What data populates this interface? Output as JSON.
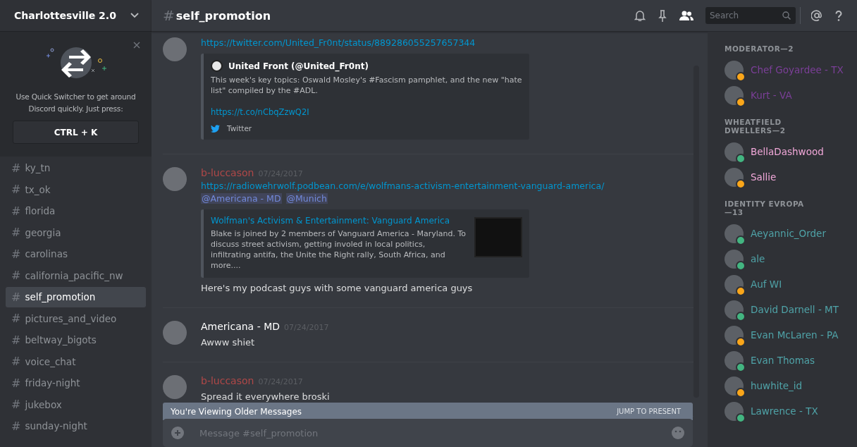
{
  "server": {
    "name": "Charlottesville 2.0"
  },
  "quick_switcher": {
    "text": "Use Quick Switcher to get around Discord quickly. Just press:",
    "shortcut": "CTRL + K"
  },
  "channels": [
    {
      "name": "ky_tn",
      "selected": false
    },
    {
      "name": "tx_ok",
      "selected": false
    },
    {
      "name": "florida",
      "selected": false
    },
    {
      "name": "georgia",
      "selected": false
    },
    {
      "name": "carolinas",
      "selected": false
    },
    {
      "name": "california_pacific_nw",
      "selected": false
    },
    {
      "name": "self_promotion",
      "selected": true
    },
    {
      "name": "pictures_and_video",
      "selected": false
    },
    {
      "name": "beltway_bigots",
      "selected": false
    },
    {
      "name": "voice_chat",
      "selected": false
    },
    {
      "name": "friday-night",
      "selected": false
    },
    {
      "name": "jukebox",
      "selected": false
    },
    {
      "name": "sunday-night",
      "selected": false
    }
  ],
  "header": {
    "hash": "#",
    "channel": "self_promotion",
    "search_placeholder": "Search",
    "members_on": true
  },
  "messages": [
    {
      "link": "https://twitter.com/United_Fr0nt/status/889286055257657344",
      "embed": {
        "kind": "tweet",
        "author": "United Front (@United_Fr0nt)",
        "description": "This week's key topics: Oswald Mosley's #Fascism pamphlet, and the new \"hate list\" compiled by the #ADL.",
        "link": "https://t.co/nCbqZzwQ2I",
        "footer": "Twitter"
      }
    },
    {
      "author": "b-luccason",
      "color": "#b04848",
      "timestamp": "07/24/2017",
      "link": "https://radiowehrwolf.podbean.com/e/wolfmans-activism-entertainment-vanguard-america/",
      "mentions": [
        "@Americana - MD",
        "@Munich"
      ],
      "embed": {
        "kind": "article",
        "title": "Wolfman's Activism & Entertainment: Vanguard America",
        "description": "Blake is joined by 2 members of Vanguard America - Maryland. To discuss street activism, getting involed in local politics, infiltrating antifa, the Unite the Right rally, South Africa, and more...."
      },
      "text": "Here's my podcast guys with some vanguard america guys"
    },
    {
      "author": "Americana - MD",
      "color": "#ffffff",
      "timestamp": "07/24/2017",
      "text": "Awww shiet"
    },
    {
      "author": "b-luccason",
      "color": "#b04848",
      "timestamp": "07/24/2017",
      "text": "Spread it everywhere broski"
    }
  ],
  "older_banner": {
    "text": "You're Viewing Older Messages",
    "action": "JUMP TO PRESENT"
  },
  "composer": {
    "placeholder": "Message #self_promotion"
  },
  "member_groups": [
    {
      "title": "MODERATOR—2",
      "color": "#7b3f98",
      "members": [
        {
          "name": "Chef Goyardee - TX",
          "color": "#faa61a"
        },
        {
          "name": "Kurt - VA",
          "color": "#faa61a"
        }
      ]
    },
    {
      "title": "WHEATFIELD DWELLERS—2",
      "color": "#f0a7d8",
      "members": [
        {
          "name": "BellaDashwood",
          "color": "#43b581"
        },
        {
          "name": "Sallie",
          "color": "#faa61a"
        }
      ]
    },
    {
      "title": "IDENTITY EVROPA—13",
      "color": "#4fa3a8",
      "members": [
        {
          "name": "Aeyannic_Order",
          "color": "#43b581"
        },
        {
          "name": "ale",
          "color": "#43b581"
        },
        {
          "name": "Auf WI",
          "color": "#faa61a"
        },
        {
          "name": "David Darnell - MT",
          "color": "#43b581"
        },
        {
          "name": "Evan McLaren - PA",
          "color": "#faa61a"
        },
        {
          "name": "Evan Thomas",
          "color": "#43b581"
        },
        {
          "name": "huwhite_id",
          "color": "#faa61a"
        },
        {
          "name": "Lawrence - TX",
          "color": "#43b581"
        }
      ]
    }
  ]
}
